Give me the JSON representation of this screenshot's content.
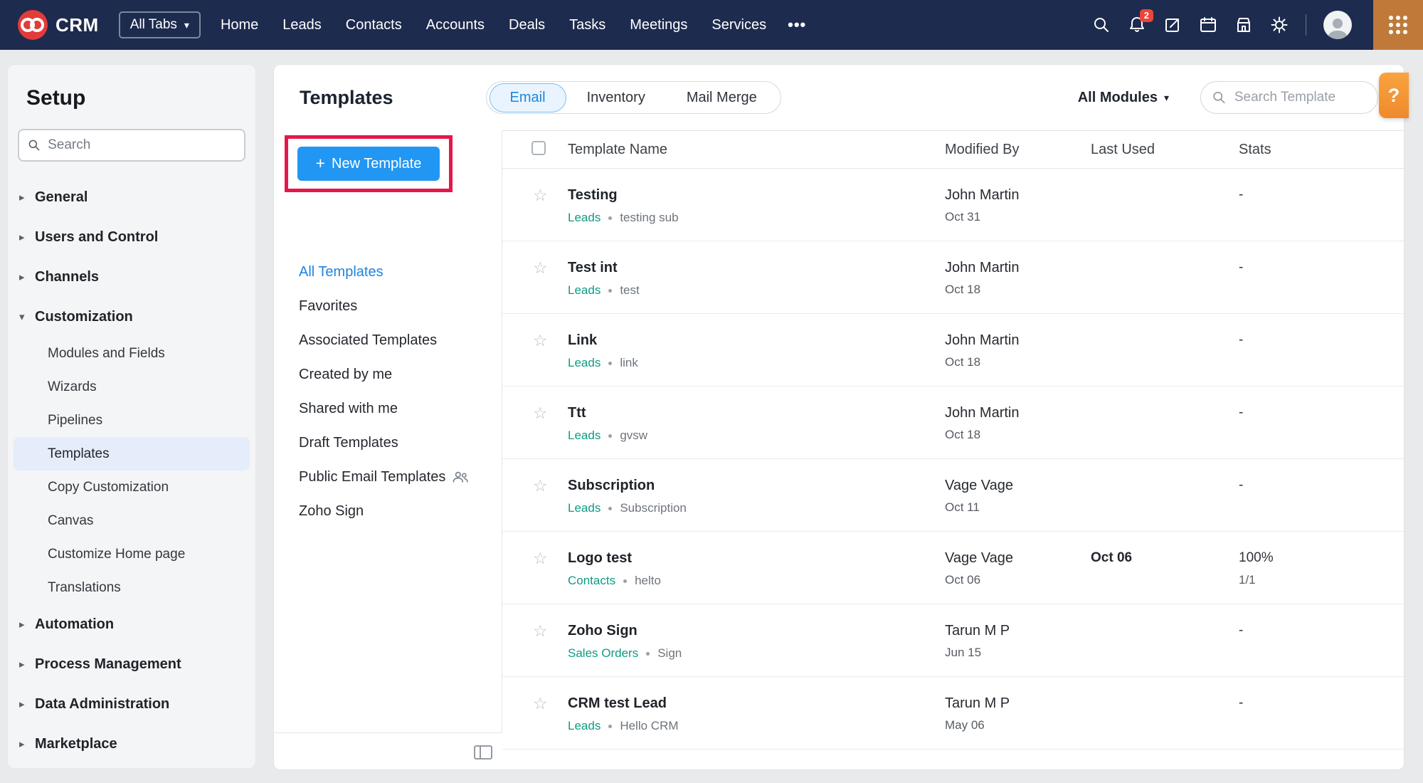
{
  "icons": {
    "star": "☆",
    "caret_down": "▾",
    "caret_right": "▸",
    "more": "•••",
    "plus": "+",
    "help": "?"
  },
  "colors": {
    "nav_background": "#1d2b4e",
    "accent_blue": "#2196f3",
    "annotation_red": "#e5174b",
    "module_link_teal": "#0f9b82",
    "selected_tab_blue": "#1c87dd",
    "help_orange": "#f5913c"
  },
  "topnav": {
    "brand": "CRM",
    "all_tabs_label": "All Tabs",
    "items": [
      "Home",
      "Leads",
      "Contacts",
      "Accounts",
      "Deals",
      "Tasks",
      "Meetings",
      "Services"
    ],
    "notification_count": "2"
  },
  "sidebar": {
    "title": "Setup",
    "search_placeholder": "Search",
    "items": [
      {
        "label": "General"
      },
      {
        "label": "Users and Control"
      },
      {
        "label": "Channels"
      },
      {
        "label": "Customization"
      },
      {
        "label": "Automation"
      },
      {
        "label": "Process Management"
      },
      {
        "label": "Data Administration"
      },
      {
        "label": "Marketplace"
      }
    ],
    "customization_children": [
      "Modules and Fields",
      "Wizards",
      "Pipelines",
      "Templates",
      "Copy Customization",
      "Canvas",
      "Customize Home page",
      "Translations"
    ],
    "selected_item": "Templates"
  },
  "main": {
    "title": "Templates",
    "tabs": [
      "Email",
      "Inventory",
      "Mail Merge"
    ],
    "selected_tab": "Email",
    "modules_filter": "All Modules",
    "search_placeholder": "Search Template",
    "subnav": {
      "new_template_label": "New Template",
      "items": [
        "All Templates",
        "Favorites",
        "Associated Templates",
        "Created by me",
        "Shared with me",
        "Draft Templates",
        "Public Email Templates",
        "Zoho Sign"
      ],
      "active_item": "All Templates"
    },
    "table": {
      "columns": [
        "Template Name",
        "Modified By",
        "Last Used",
        "Stats"
      ],
      "rows": [
        {
          "name": "Testing",
          "module": "Leads",
          "subject": "testing sub",
          "modified_by": "John Martin",
          "modified_date": "Oct 31",
          "last_used": "",
          "stats": "-",
          "stats_detail": ""
        },
        {
          "name": "Test int",
          "module": "Leads",
          "subject": "test",
          "modified_by": "John Martin",
          "modified_date": "Oct 18",
          "last_used": "",
          "stats": "-",
          "stats_detail": ""
        },
        {
          "name": "Link",
          "module": "Leads",
          "subject": "link",
          "modified_by": "John Martin",
          "modified_date": "Oct 18",
          "last_used": "",
          "stats": "-",
          "stats_detail": ""
        },
        {
          "name": "Ttt",
          "module": "Leads",
          "subject": "gvsw",
          "modified_by": "John Martin",
          "modified_date": "Oct 18",
          "last_used": "",
          "stats": "-",
          "stats_detail": ""
        },
        {
          "name": "Subscription",
          "module": "Leads",
          "subject": "Subscription",
          "modified_by": "Vage Vage",
          "modified_date": "Oct 11",
          "last_used": "",
          "stats": "-",
          "stats_detail": ""
        },
        {
          "name": "Logo test",
          "module": "Contacts",
          "subject": "helto",
          "modified_by": "Vage Vage",
          "modified_date": "Oct 06",
          "last_used": "Oct 06",
          "stats": "100%",
          "stats_detail": "1/1"
        },
        {
          "name": "Zoho Sign",
          "module": "Sales Orders",
          "subject": "Sign",
          "modified_by": "Tarun M P",
          "modified_date": "Jun 15",
          "last_used": "",
          "stats": "-",
          "stats_detail": ""
        },
        {
          "name": "CRM test Lead",
          "module": "Leads",
          "subject": "Hello CRM",
          "modified_by": "Tarun M P",
          "modified_date": "May 06",
          "last_used": "",
          "stats": "-",
          "stats_detail": ""
        }
      ]
    }
  }
}
